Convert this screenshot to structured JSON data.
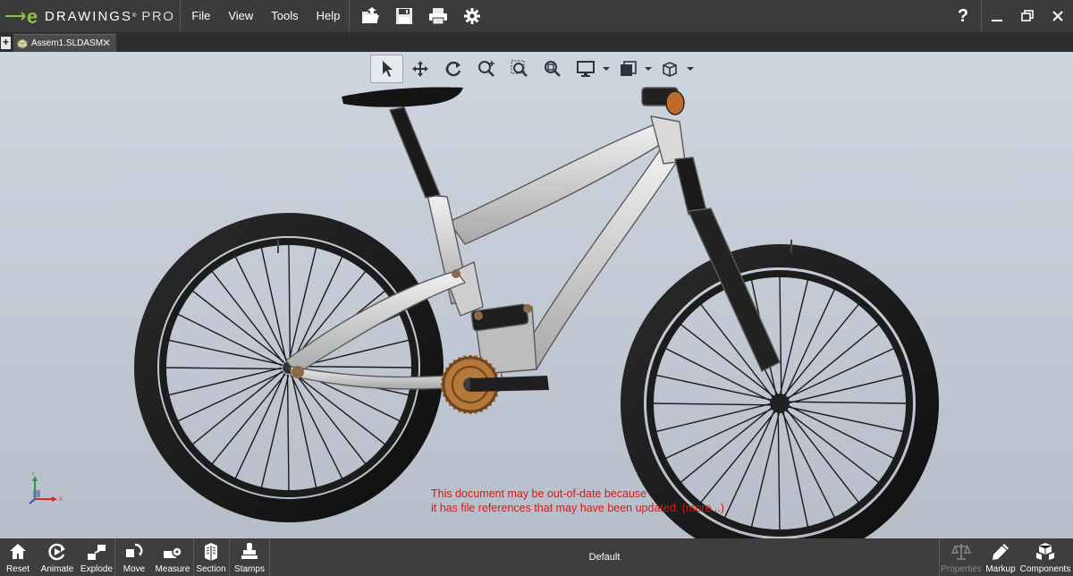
{
  "app": {
    "logo_letter": "e",
    "logo_name": "DRAWINGS",
    "logo_mark": "®",
    "logo_edition": "PRO"
  },
  "menu": [
    {
      "label": "File"
    },
    {
      "label": "View"
    },
    {
      "label": "Tools"
    },
    {
      "label": "Help"
    }
  ],
  "window": {
    "help_label": "?"
  },
  "tabs": [
    {
      "label": "Assem1.SLDASM",
      "close": "✕"
    }
  ],
  "tab_add_label": "+",
  "warning": {
    "line1": "This document may be out-of-date because",
    "line2": "it has file references that may have been updated.",
    "more": "(more...)"
  },
  "triad": {
    "y": "Y",
    "x": "X"
  },
  "bottom": {
    "left_buttons": [
      {
        "label": "Reset",
        "icon": "house-icon"
      },
      {
        "label": "Animate",
        "icon": "animate-icon"
      },
      {
        "label": "Explode",
        "icon": "explode-icon"
      }
    ],
    "tool_buttons": [
      {
        "label": "Move",
        "icon": "move-icon"
      },
      {
        "label": "Measure",
        "icon": "measure-icon"
      },
      {
        "label": "Section",
        "icon": "section-icon"
      },
      {
        "label": "Stamps",
        "icon": "stamp-icon"
      }
    ],
    "configuration": "Default",
    "right_buttons": [
      {
        "label": "Properties",
        "icon": "scales-icon",
        "enabled": false
      },
      {
        "label": "Markup",
        "icon": "pen-icon",
        "enabled": true
      },
      {
        "label": "Components",
        "icon": "cubes-icon",
        "enabled": true
      }
    ]
  },
  "colors": {
    "titlebar": "#3b3b3b",
    "viewport_top": "#cfd5df",
    "viewport_bottom": "#b7bdc9",
    "warning": "#e3140f",
    "logo_green": "#8cc63f"
  }
}
